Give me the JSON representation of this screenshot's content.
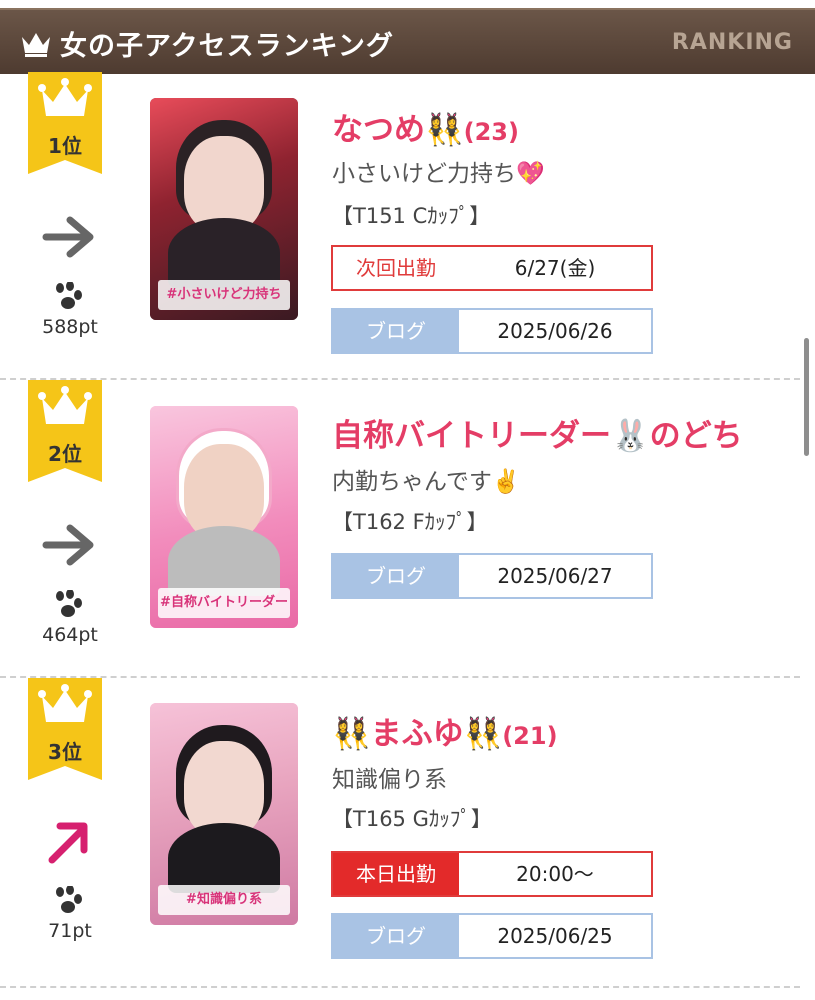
{
  "header": {
    "title": "女の子アクセスランキング",
    "subtitle": "RANKING"
  },
  "colors": {
    "header_bg": "#5a4538",
    "gold": "#f5c518",
    "name": "#e43d66",
    "next": "#e03b3b",
    "blog": "#a9c3e4",
    "trend_flat": "#666666",
    "trend_up": "#d6206f"
  },
  "ranking": [
    {
      "rank": "1位",
      "trend": "flat",
      "trend_icon": "arrow-right-icon",
      "points": "588pt",
      "name": "なつめ👯‍♀️",
      "age": "(23)",
      "catch": "小さいけど力持ち💖",
      "size": "【T151 Cｶｯﾌﾟ】",
      "photo_tag": "#小さいけど力持ち",
      "schedule": {
        "label": "次回出勤",
        "value": "6/27(金)"
      },
      "blog": {
        "label": "ブログ",
        "value": "2025/06/26"
      }
    },
    {
      "rank": "2位",
      "trend": "flat",
      "trend_icon": "arrow-right-icon",
      "points": "464pt",
      "name": "自称バイトリーダー🐰のどち",
      "age": "",
      "catch": "内勤ちゃんです✌️",
      "size": "【T162 Fｶｯﾌﾟ】",
      "photo_tag": "#自称バイトリーダー",
      "blog": {
        "label": "ブログ",
        "value": "2025/06/27"
      }
    },
    {
      "rank": "3位",
      "trend": "up",
      "trend_icon": "arrow-up-right-icon",
      "points": "71pt",
      "name": "👯‍♀️まふゆ👯‍♀️",
      "age": "(21)",
      "catch": "知識偏り系",
      "size": "【T165 Gｶｯﾌﾟ】",
      "photo_tag": "#知識偏り系",
      "schedule": {
        "label": "本日出勤",
        "value": "20:00〜"
      },
      "blog": {
        "label": "ブログ",
        "value": "2025/06/25"
      }
    }
  ]
}
